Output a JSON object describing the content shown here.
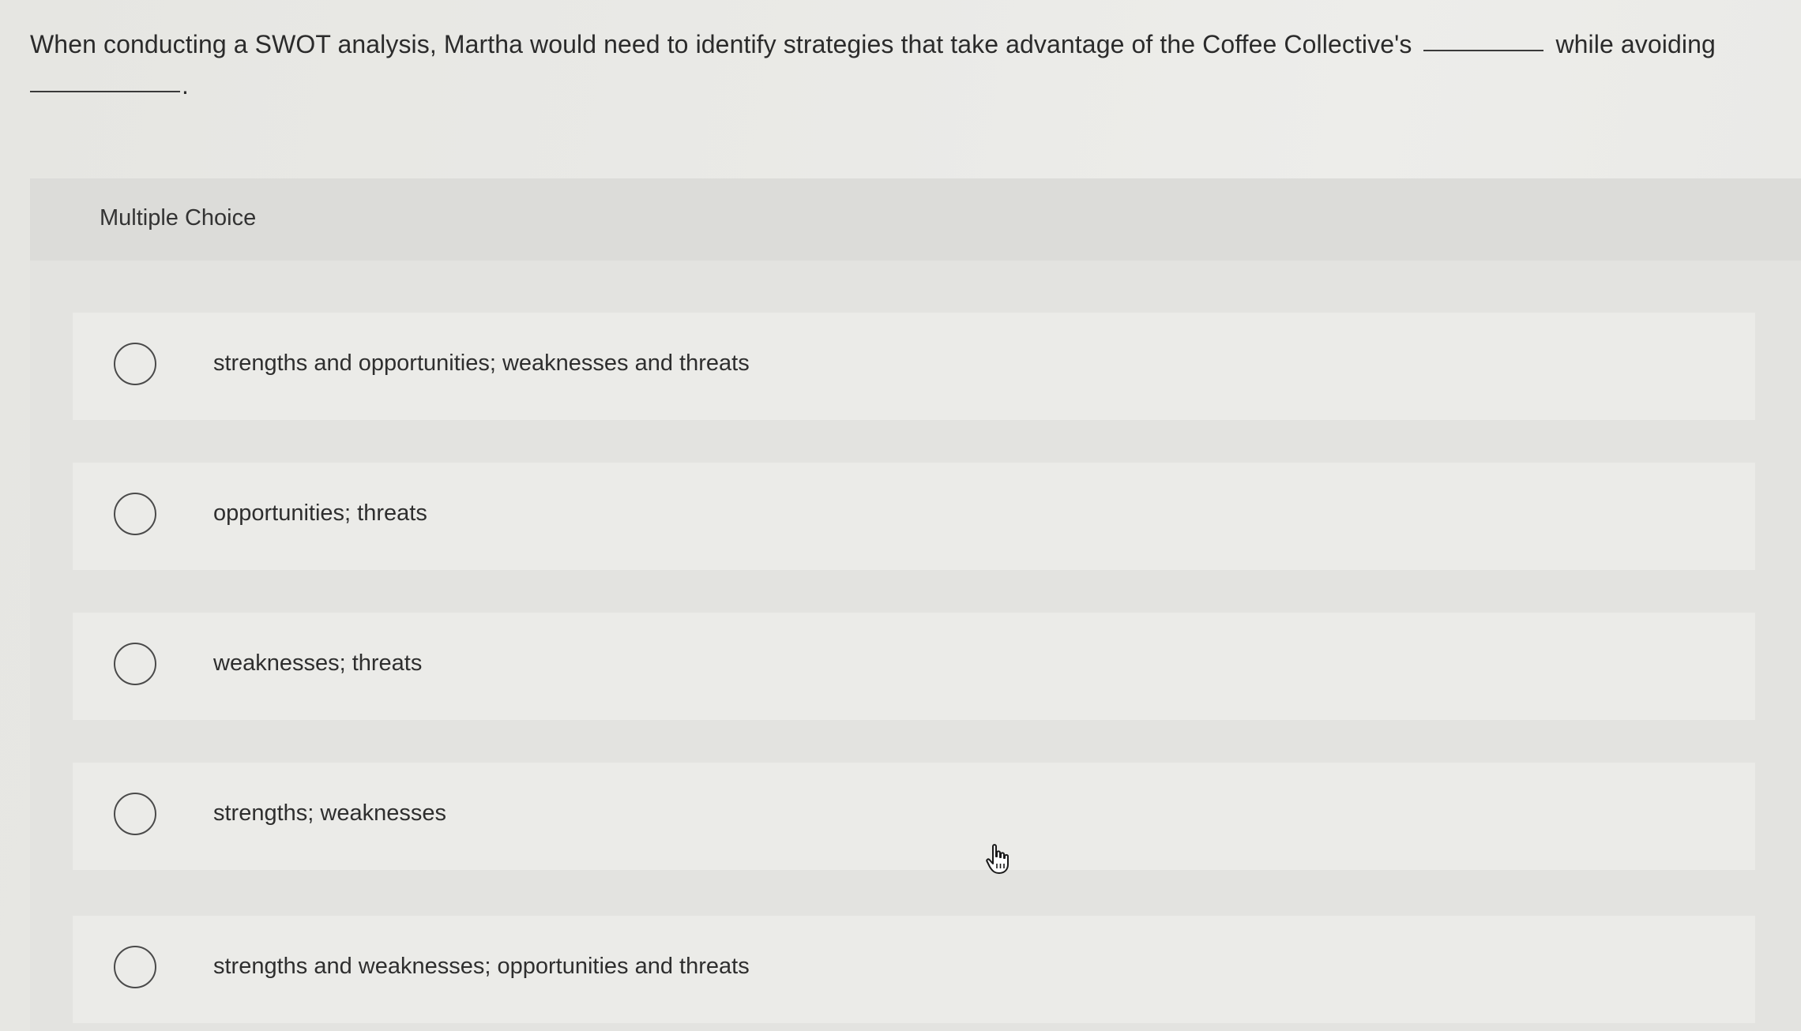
{
  "question": {
    "part1": "When conducting a SWOT analysis, Martha would need to identify strategies that take advantage of the Coffee Collective's",
    "part2": "while avoiding",
    "end_punct": "."
  },
  "multiple_choice": {
    "header": "Multiple Choice",
    "options": [
      {
        "label": "strengths and opportunities; weaknesses and threats"
      },
      {
        "label": "opportunities; threats"
      },
      {
        "label": "weaknesses; threats"
      },
      {
        "label": "strengths; weaknesses"
      },
      {
        "label": "strengths and weaknesses; opportunities and threats"
      }
    ]
  },
  "icons": {
    "radio": "radio-unselected-icon",
    "cursor": "hand-pointer-icon"
  }
}
